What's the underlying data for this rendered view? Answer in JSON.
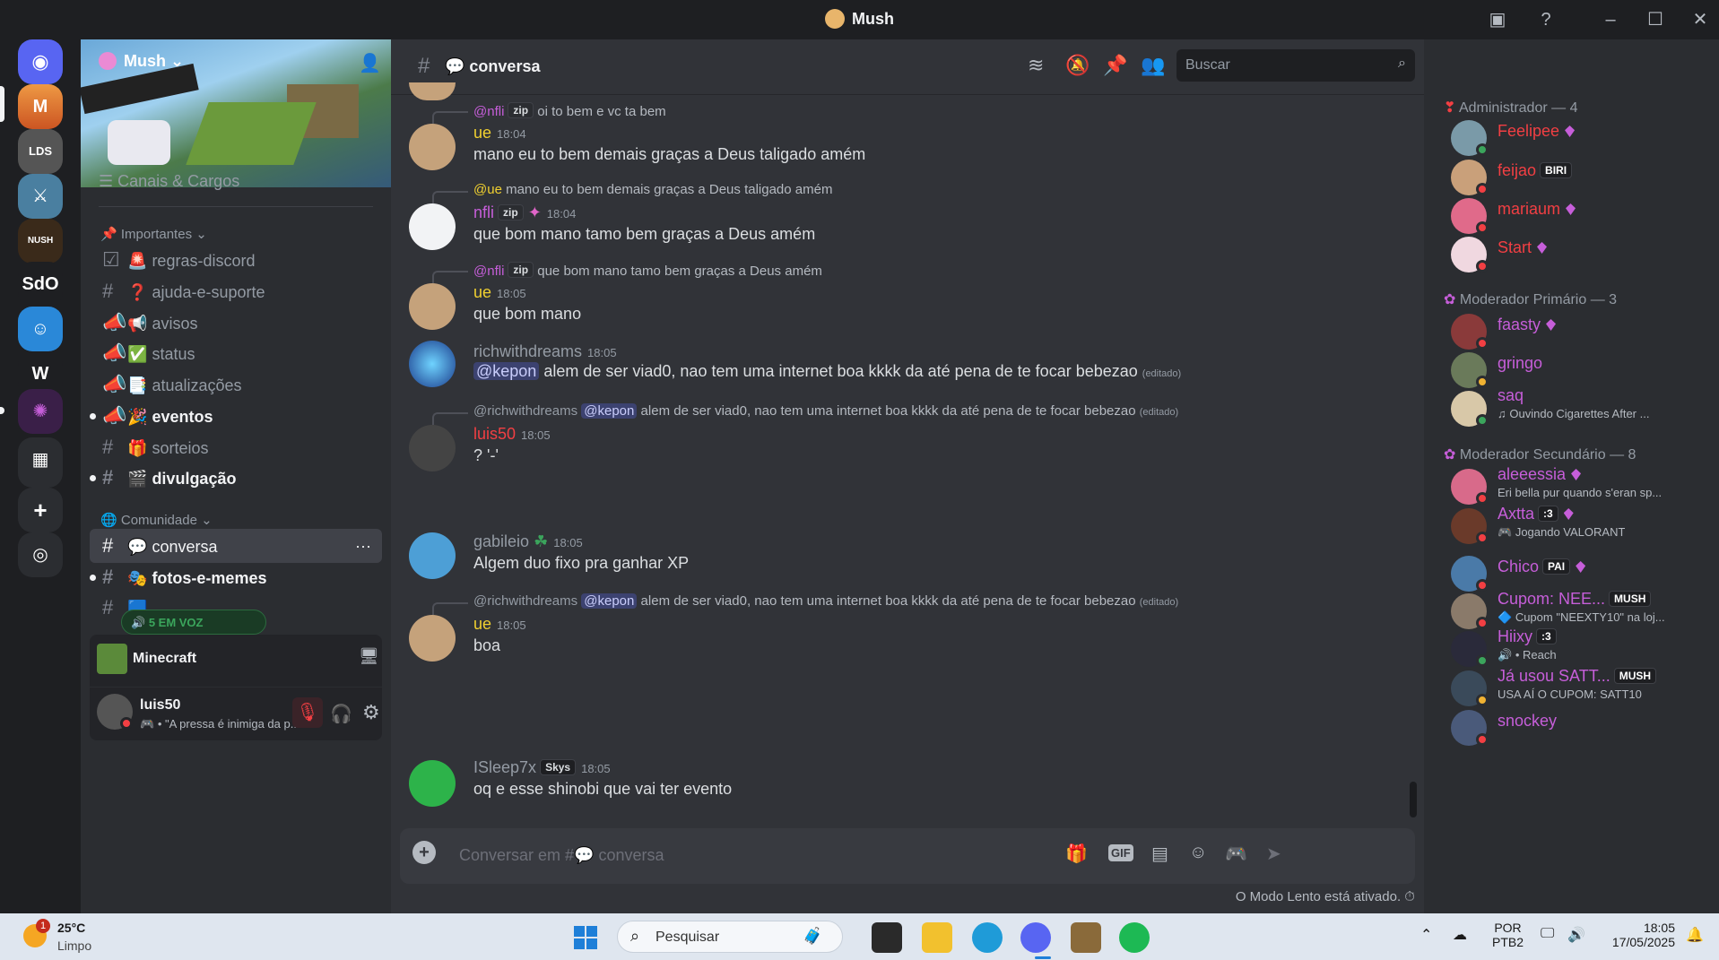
{
  "window": {
    "title": "Mush"
  },
  "rail": {
    "servers": [
      "SdO"
    ]
  },
  "sidebar": {
    "server_name": "Mush",
    "channels_roles": "Canais & Cargos",
    "cat_important": "Importantes",
    "channels": [
      {
        "emoji": "🚨",
        "name": "regras-discord"
      },
      {
        "emoji": "❓",
        "name": "ajuda-e-suporte"
      },
      {
        "emoji": "📢",
        "name": "avisos"
      },
      {
        "emoji": "✅",
        "name": "status"
      },
      {
        "emoji": "📑",
        "name": "atualizações"
      },
      {
        "emoji": "🎉",
        "name": "eventos"
      },
      {
        "emoji": "🎁",
        "name": "sorteios"
      },
      {
        "emoji": "🎬",
        "name": "divulgação"
      }
    ],
    "cat_community": "Comunidade",
    "community_channels": [
      {
        "emoji": "💬",
        "name": "conversa"
      },
      {
        "emoji": "🎭",
        "name": "fotos-e-memes"
      }
    ],
    "voice_pill": "5 EM VOZ",
    "activity": "Minecraft",
    "user": {
      "name": "luis50",
      "status": "• \"A pressa é inimiga da p..."
    }
  },
  "chat": {
    "channel": "conversa",
    "search_placeholder": "Buscar",
    "composer_placeholder": "Conversar em #💬 conversa",
    "slowmode": "O Modo Lento está ativado.",
    "messages": [
      {
        "reply_name": "@nfli",
        "reply_tag": "zip",
        "reply_text": "oi to bem e vc ta bem",
        "name": "ue",
        "time": "18:04",
        "text": "mano eu to bem demais graças a Deus taligado amém",
        "color": "#f0d030"
      },
      {
        "reply_name": "@ue",
        "reply_text": "mano eu to bem demais graças a Deus taligado amém",
        "name": "nfli",
        "tag": "zip",
        "time": "18:04",
        "text": "que bom mano tamo bem graças a Deus amém",
        "color": "#c65ed9"
      },
      {
        "reply_name": "@nfli",
        "reply_tag": "zip",
        "reply_text": "que bom mano tamo bem graças a Deus amém",
        "name": "ue",
        "time": "18:05",
        "text": "que bom mano",
        "color": "#f0d030"
      },
      {
        "name": "richwithdreams",
        "time": "18:05",
        "mention": "@kepon",
        "text": "alem de ser viad0, nao tem uma internet boa kkkk da até pena de te focar bebezao",
        "edited": "(editado)",
        "color": "#949ba4"
      },
      {
        "reply_name": "@richwithdreams",
        "reply_mention": "@kepon",
        "reply_text": "alem de ser viad0, nao tem uma internet boa kkkk da até pena de te focar bebezao",
        "reply_edited": "(editado)",
        "name": "luis50",
        "time": "18:05",
        "text": "? '-'",
        "color": "#f23f43"
      },
      {
        "name": "gabileio",
        "time": "18:05",
        "text": "Algem duo fixo pra ganhar XP",
        "color": "#949ba4"
      },
      {
        "reply_name": "@richwithdreams",
        "reply_mention": "@kepon",
        "reply_text": "alem de ser viad0, nao tem uma internet boa kkkk da até pena de te focar bebezao",
        "reply_edited": "(editado)",
        "name": "ue",
        "time": "18:05",
        "text": "boa",
        "color": "#f0d030"
      },
      {
        "name": "ISleep7x",
        "tag": "Skys",
        "time": "18:05",
        "text": "oq e esse shinobi que vai ter evento",
        "color": "#949ba4"
      }
    ]
  },
  "members": {
    "roles": [
      {
        "name": "Administrador — 4"
      },
      {
        "name": "Moderador Primário — 3"
      },
      {
        "name": "Moderador Secundário — 8"
      }
    ],
    "list": [
      {
        "name": "Feelipee",
        "color": "#f23f43"
      },
      {
        "name": "feijao",
        "color": "#f23f43",
        "badge": "BIRI"
      },
      {
        "name": "mariaum",
        "color": "#f23f43"
      },
      {
        "name": "Start",
        "color": "#f23f43"
      },
      {
        "name": "faasty",
        "color": "#c65ed9"
      },
      {
        "name": "gringo",
        "color": "#c65ed9"
      },
      {
        "name": "saq",
        "color": "#c65ed9",
        "sub": "Ouvindo Cigarettes After ..."
      },
      {
        "name": "aleeessia",
        "color": "#c65ed9",
        "sub": "Eri bella pur quando s'eran sp..."
      },
      {
        "name": "Axtta",
        "color": "#c65ed9",
        "badge": ":3",
        "sub": "Jogando VALORANT"
      },
      {
        "name": "Chico",
        "color": "#c65ed9",
        "badge": "PAI"
      },
      {
        "name": "Cupom: NEE...",
        "color": "#c65ed9",
        "badge": "MUSH",
        "sub": "Cupom \"NEEXTY10\" na loj..."
      },
      {
        "name": "Hiixy",
        "color": "#c65ed9",
        "badge": ":3",
        "sub": "• Reach"
      },
      {
        "name": "Já usou SATT...",
        "color": "#c65ed9",
        "badge": "MUSH",
        "sub": "USA AÍ O CUPOM: SATT10"
      },
      {
        "name": "snockey",
        "color": "#c65ed9"
      }
    ]
  },
  "taskbar": {
    "weather_temp": "25°C",
    "weather_desc": "Limpo",
    "weather_badge": "1",
    "search": "Pesquisar",
    "lang1": "POR",
    "lang2": "PTB2",
    "time": "18:05",
    "date": "17/05/2025"
  }
}
